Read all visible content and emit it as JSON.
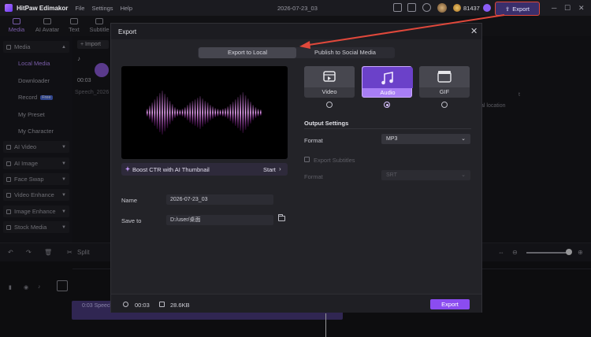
{
  "app": {
    "name": "HitPaw Edimakor",
    "menu": [
      "File",
      "Settings",
      "Help"
    ],
    "doc_title": "2026-07-23_03",
    "credits": "81437",
    "export_label": "Export"
  },
  "tabs": [
    {
      "label": "Media",
      "active": true
    },
    {
      "label": "AI Avatar",
      "active": false
    },
    {
      "label": "Text",
      "active": false
    },
    {
      "label": "Subtitle",
      "active": false
    }
  ],
  "sidebar": {
    "items": [
      {
        "label": "Media",
        "type": "group"
      },
      {
        "label": "Local Media",
        "type": "sub",
        "active": true
      },
      {
        "label": "Downloader",
        "type": "sub"
      },
      {
        "label": "Record",
        "type": "sub",
        "badge": "Free"
      },
      {
        "label": "My Preset",
        "type": "sub"
      },
      {
        "label": "My Character",
        "type": "sub"
      },
      {
        "label": "AI Video",
        "type": "group"
      },
      {
        "label": "AI Image",
        "type": "group"
      },
      {
        "label": "Face Swap",
        "type": "group"
      },
      {
        "label": "Video Enhance",
        "type": "group"
      },
      {
        "label": "Image Enhance",
        "type": "group"
      },
      {
        "label": "Stock Media",
        "type": "group"
      }
    ]
  },
  "media": {
    "import_label": "Import",
    "duration": "00:03",
    "file_name": "Speech_2026"
  },
  "right_panel": {
    "line1": "t",
    "line2": "al location"
  },
  "toolbar": {
    "split_label": "Split"
  },
  "timeline": {
    "clip_label": "0:03 Speech"
  },
  "dialog": {
    "title": "Export",
    "tabs": [
      {
        "label": "Export to Local",
        "active": true
      },
      {
        "label": "Publish to Social Media",
        "active": false
      }
    ],
    "boost": {
      "text": "Boost CTR with AI Thumbnail",
      "action": "Start"
    },
    "name_label": "Name",
    "name_value": "2026-07-23_03",
    "save_label": "Save to",
    "save_value": "D:/user/桌面",
    "formats": [
      {
        "label": "Video",
        "icon": "film-icon",
        "selected": false
      },
      {
        "label": "Audio",
        "icon": "music-note-icon",
        "selected": true
      },
      {
        "label": "GIF",
        "icon": "gif-icon",
        "selected": false
      }
    ],
    "output_settings_title": "Output Settings",
    "format_label": "Format",
    "format_value": "MP3",
    "export_subtitles_label": "Export Subtitles",
    "subtitle_format_label": "Format",
    "subtitle_format_value": "SRT",
    "footer": {
      "duration": "00:03",
      "size": "28.6KB",
      "export_label": "Export"
    }
  },
  "colors": {
    "accent": "#8b4cf0",
    "highlight_border": "#e0483b"
  }
}
